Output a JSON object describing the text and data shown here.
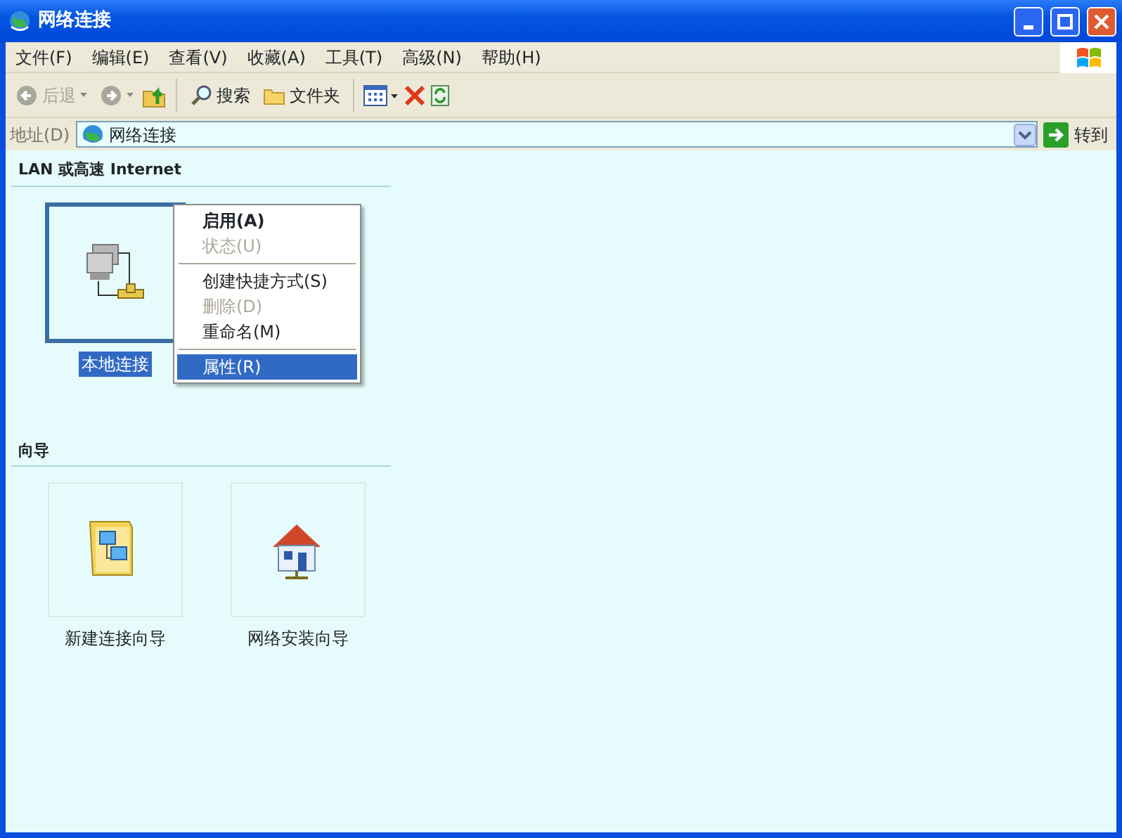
{
  "window": {
    "title": "网络连接"
  },
  "menu_bar": [
    {
      "label": "文件(F)"
    },
    {
      "label": "编辑(E)"
    },
    {
      "label": "查看(V)"
    },
    {
      "label": "收藏(A)"
    },
    {
      "label": "工具(T)"
    },
    {
      "label": "高级(N)"
    },
    {
      "label": "帮助(H)"
    }
  ],
  "toolbar": {
    "back": {
      "label": "后退",
      "disabled": true
    },
    "forward": {
      "disabled": true
    },
    "search": {
      "label": "搜索"
    },
    "folders": {
      "label": "文件夹"
    }
  },
  "address_bar": {
    "label": "地址(D)",
    "value": "网络连接",
    "go_label": "转到"
  },
  "groups": [
    {
      "title": "LAN 或高速 Internet",
      "items": [
        {
          "label": "本地连接",
          "kind": "network",
          "selected": true
        }
      ]
    },
    {
      "title": "向导",
      "items": [
        {
          "label": "新建连接向导",
          "kind": "wizard",
          "selected": false
        },
        {
          "label": "网络安装向导",
          "kind": "home",
          "selected": false
        }
      ]
    }
  ],
  "context_menu": [
    {
      "kind": "item",
      "label": "启用(A)",
      "default": true,
      "disabled": false,
      "selected": false
    },
    {
      "kind": "item",
      "label": "状态(U)",
      "default": false,
      "disabled": true,
      "selected": false
    },
    {
      "kind": "separator"
    },
    {
      "kind": "item",
      "label": "创建快捷方式(S)",
      "default": false,
      "disabled": false,
      "selected": false
    },
    {
      "kind": "item",
      "label": "删除(D)",
      "default": false,
      "disabled": true,
      "selected": false
    },
    {
      "kind": "item",
      "label": "重命名(M)",
      "default": false,
      "disabled": false,
      "selected": false
    },
    {
      "kind": "separator"
    },
    {
      "kind": "item",
      "label": "属性(R)",
      "default": false,
      "disabled": false,
      "selected": true
    }
  ]
}
